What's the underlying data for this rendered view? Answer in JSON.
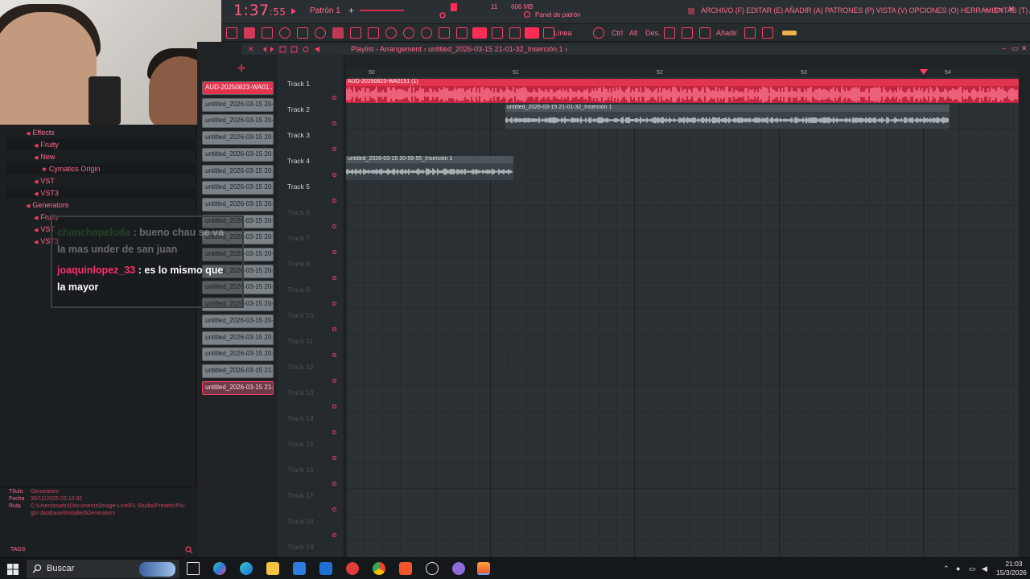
{
  "topbar": {
    "time_main": "1:37",
    "time_small": ":55",
    "pattern_label": "Patrón 1",
    "pattern_add": "+",
    "cpu_readout": "11",
    "ram_readout": "606 MB",
    "panel_label": "Panel de patrón",
    "menu": "ARCHIVO (F)  EDITAR (E)  AÑADIR (A)  PATRONES (P)  VISTA (V)  OPCIONES (O)  HERRAMIENTAS (T)  AYUDA",
    "min": "–",
    "max": "▭",
    "close": "✕"
  },
  "toolbar": {
    "line_label": "Línea",
    "ctrl_label": "Ctrl",
    "alt_label": "Alt",
    "des_label": "Des.",
    "add_label": "Añadir"
  },
  "browser": {
    "items": [
      {
        "label": "Effects",
        "level": 0
      },
      {
        "label": "Fruity",
        "level": 1
      },
      {
        "label": "New",
        "level": 1
      },
      {
        "label": "Cymatics Origin",
        "level": 2
      },
      {
        "label": "VST",
        "level": 1
      },
      {
        "label": "VST3",
        "level": 1
      },
      {
        "label": "Generators",
        "level": 0
      },
      {
        "label": "Fruity",
        "level": 1
      },
      {
        "label": "VST",
        "level": 1
      },
      {
        "label": "VST3",
        "level": 1
      }
    ],
    "info": {
      "title_label": "Título",
      "title_value": "Generators",
      "date_label": "Fecha",
      "date_value": "30/12/2025 02:10:32",
      "path_label": "Ruta",
      "path_value_1": "C:\\Users\\mattu\\Documents\\Image-Line\\FL Studio\\Presets\\Plu-",
      "path_value_2": "gin database\\Installed\\Generators"
    },
    "tags_label": "TAGS"
  },
  "chat": {
    "user1": "chanchapeluda",
    "msg1a": ": bueno chau se va",
    "msg1b": "la mas under de san juan",
    "user2": "joaquinlopez_33",
    "msg2a": ": es lo mismo que",
    "msg2b": "la mayor"
  },
  "cliplist": [
    "AUD-20250823-WA01...",
    "untitled_2026-03-15 20-...",
    "untitled_2026-03-15 20-...",
    "untitled_2026-03-15 20-...",
    "untitled_2026-03-15 20-...",
    "untitled_2026-03-15 20-...",
    "untitled_2026-03-15 20-...",
    "untitled_2026-03-15 20-...",
    "untitled_2026-03-15 20-...",
    "untitled_2026-03-15 20-...",
    "untitled_2026-03-15 20-...",
    "untitled_2026-03-15 20-...",
    "untitled_2026-03-15 20-...",
    "untitled_2026-03-15 20-...",
    "untitled_2026-03-15 20-...",
    "untitled_2026-03-15 20-...",
    "untitled_2026-03-15 20-...",
    "untitled_2026-03-15 21-...",
    "untitled_2026-03-15 21-..."
  ],
  "playlist": {
    "title": "Playlist - Arrangement › untitled_2026-03-15 21-01-32_Inserción 1 ›",
    "tracks": [
      "Track 1",
      "Track 2",
      "Track 3",
      "Track 4",
      "Track 5",
      "Track 6",
      "Track 7",
      "Track 8",
      "Track 9",
      "Track 10",
      "Track 11",
      "Track 12",
      "Track 13",
      "Track 14",
      "Track 15",
      "Track 16",
      "Track 17",
      "Track 18",
      "Track 19"
    ],
    "bars": [
      "50",
      "51",
      "52",
      "53",
      "54"
    ],
    "clips": [
      {
        "name": "AUD-20250823-WA0151 (1)",
        "track": 1
      },
      {
        "name": "untitled_2026-03-15 21-01-32_Inserción 1",
        "track": 2
      },
      {
        "name": "untitled_2026-03-15 20-59-55_Inserción 1",
        "track": 4
      }
    ]
  },
  "taskbar": {
    "search": "Buscar",
    "time": "21:03",
    "date": "15/3/2026"
  },
  "colors": {
    "accent": "#ff2d55",
    "panel": "#1f2326",
    "grid": "#2b3135"
  }
}
